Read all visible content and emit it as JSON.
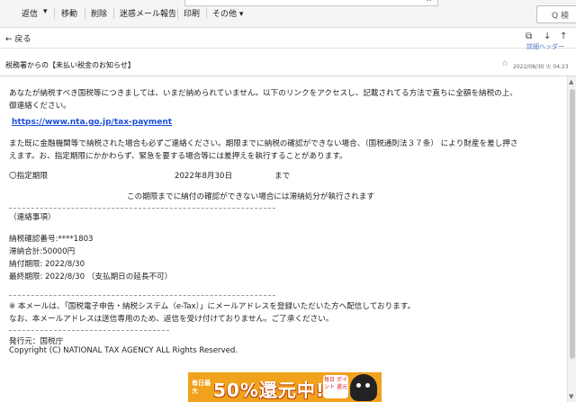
{
  "toolbar": {
    "reply": "返信",
    "move": "移動",
    "delete": "削除",
    "spam_report": "迷惑メール報告",
    "print": "印刷",
    "other": "その他"
  },
  "search": {
    "label": "Q 検"
  },
  "nav": {
    "back": "← 戻る",
    "header_detail": "詳細ヘッダー"
  },
  "message": {
    "subject": "税務署からの【未払い税金のお知らせ】",
    "date": "2022/08/30 火 04:23"
  },
  "body": {
    "line1": "あなたが納税すべき国税等につきましては、いまだ納められていません。以下のリンクをアクセスし、記載されてる方法で直ちに全額を納税の上、",
    "line2": "御連絡ください。",
    "link": "https://www.nta.go.jp/tax-payment",
    "line3": "また既に金融機関等で納税された場合も必ずご連絡ください。期限までに納税の確認ができない場合、（国税通則法３７条） により財産を差し押さ",
    "line4": "えます。お、指定期限にかかわらず、緊急を要する場合等には差押えを執行することがあります。",
    "deadline_label": "〇指定期限",
    "deadline_date": "2022年8月30日",
    "deadline_suffix": "まで",
    "warning": "この期限までに納付の確認ができない場合には滞納処分が執行されます",
    "contact_header": "（連絡事項）",
    "confirmation_no": "納税確認番号:****1803",
    "arrears_total": "滞納合計:50000円",
    "payment_deadline": "納付期限: 2022/8/30",
    "final_deadline": "最終期限: 2022/8/30 （支払期日の延長不可）",
    "notice1": "※ 本メールは、「国税電子申告・納税システム（e-Tax）」にメールアドレスを登録いただいた方へ配信しております。",
    "notice2": "なお、本メールアドレスは送信専用のため、返信を受け付けておりません。ご了承ください。",
    "issuer": "発行元：国税庁",
    "copyright": "Copyright (C) NATIONAL TAX AGENCY ALL Rights Reserved."
  },
  "banner": {
    "small_text": "毎日最大",
    "main_text": "50%還元中!",
    "badge_text": "毎日 ポイント 還元"
  },
  "colors": {
    "link": "#1a4fd6",
    "banner_bg": "#f0a21d",
    "header_link": "#4a74c9"
  }
}
